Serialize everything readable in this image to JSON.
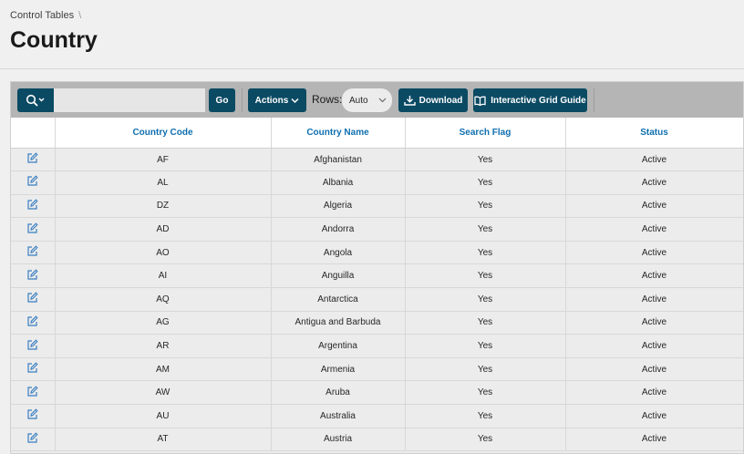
{
  "breadcrumb": {
    "parent": "Control Tables",
    "separator": "\\"
  },
  "page": {
    "title": "Country"
  },
  "toolbar": {
    "search_placeholder": "",
    "go_label": "Go",
    "actions_label": "Actions",
    "rows_label": "Rows:",
    "rows_value": "Auto",
    "download_label": "Download",
    "guide_label": "Interactive Grid Guide",
    "button_color": "#0b4a63"
  },
  "grid": {
    "columns": [
      "Country Code",
      "Country Name",
      "Search Flag",
      "Status"
    ],
    "header_color": "#0f6fb0",
    "rows": [
      [
        "AF",
        "Afghanistan",
        "Yes",
        "Active"
      ],
      [
        "AL",
        "Albania",
        "Yes",
        "Active"
      ],
      [
        "DZ",
        "Algeria",
        "Yes",
        "Active"
      ],
      [
        "AD",
        "Andorra",
        "Yes",
        "Active"
      ],
      [
        "AO",
        "Angola",
        "Yes",
        "Active"
      ],
      [
        "AI",
        "Anguilla",
        "Yes",
        "Active"
      ],
      [
        "AQ",
        "Antarctica",
        "Yes",
        "Active"
      ],
      [
        "AG",
        "Antigua and Barbuda",
        "Yes",
        "Active"
      ],
      [
        "AR",
        "Argentina",
        "Yes",
        "Active"
      ],
      [
        "AM",
        "Armenia",
        "Yes",
        "Active"
      ],
      [
        "AW",
        "Aruba",
        "Yes",
        "Active"
      ],
      [
        "AU",
        "Australia",
        "Yes",
        "Active"
      ],
      [
        "AT",
        "Austria",
        "Yes",
        "Active"
      ]
    ],
    "edit_icon": "edit-pencil-icon"
  }
}
